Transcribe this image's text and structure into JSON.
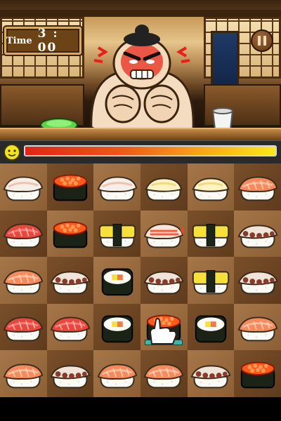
{
  "hud": {
    "time_label": "Time",
    "time_value": "3 : 00",
    "pause_icon": "pause-icon"
  },
  "progress": {
    "level": 1.0,
    "colors": [
      "#e02518",
      "#f8a616",
      "#fbe81a"
    ]
  },
  "characters": {
    "chef": "angry-sumo-chef"
  },
  "board": {
    "columns": 6,
    "rows": 5,
    "cells": [
      [
        "tai-nigiri",
        "ikura-gunkan",
        "tai-nigiri",
        "hotate-nigiri",
        "hotate-nigiri",
        "salmon-nigiri"
      ],
      [
        "maguro-nigiri",
        "ikura-gunkan",
        "tamago-nigiri",
        "ebi-nigiri",
        "tamago-nigiri",
        "tako-nigiri"
      ],
      [
        "salmon-nigiri",
        "tako-nigiri",
        "maki-roll",
        "tako-nigiri",
        "tamago-nigiri",
        "tako-nigiri"
      ],
      [
        "maguro-nigiri",
        "maguro-nigiri",
        "maki-roll",
        "ikura-gunkan",
        "maki-roll",
        "salmon-nigiri"
      ],
      [
        "salmon-nigiri",
        "tako-nigiri",
        "salmon-nigiri",
        "salmon-nigiri",
        "tako-nigiri",
        "ikura-gunkan"
      ]
    ],
    "hint_cell": [
      3,
      3
    ]
  }
}
